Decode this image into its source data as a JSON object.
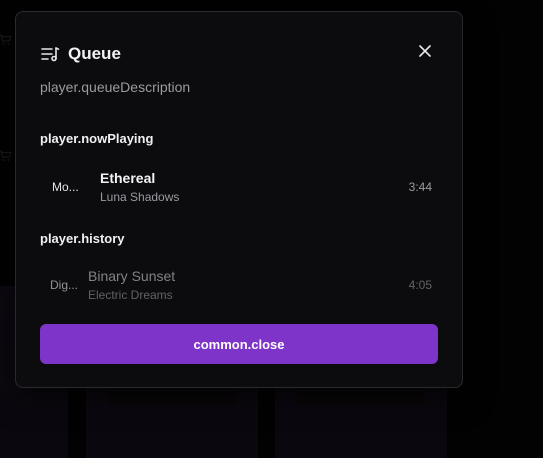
{
  "dialog": {
    "title": "Queue",
    "description": "player.queueDescription",
    "icons": {
      "header": "queue-list-icon",
      "close": "close-icon"
    }
  },
  "now_playing": {
    "label": "player.nowPlaying",
    "track": {
      "thumb": "Mo...",
      "title": "Ethereal",
      "artist": "Luna Shadows",
      "duration": "3:44"
    }
  },
  "history": {
    "label": "player.history",
    "tracks": [
      {
        "thumb": "Dig...",
        "title": "Binary Sunset",
        "artist": "Electric Dreams",
        "duration": "4:05"
      }
    ]
  },
  "actions": {
    "close_label": "common.close"
  },
  "colors": {
    "accent": "#7e33c9",
    "dialog_bg": "#0c0c0e",
    "muted_text": "#9a9aa2"
  }
}
